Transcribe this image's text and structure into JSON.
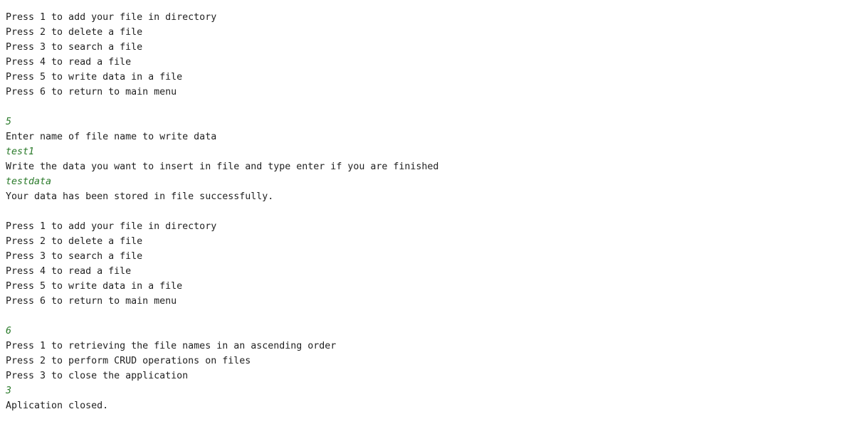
{
  "console": {
    "lines": [
      {
        "text": "Press 1 to add your file in directory",
        "kind": "output"
      },
      {
        "text": "Press 2 to delete a file",
        "kind": "output"
      },
      {
        "text": "Press 3 to search a file",
        "kind": "output"
      },
      {
        "text": "Press 4 to read a file",
        "kind": "output"
      },
      {
        "text": "Press 5 to write data in a file",
        "kind": "output"
      },
      {
        "text": "Press 6 to return to main menu",
        "kind": "output"
      },
      {
        "text": "",
        "kind": "output"
      },
      {
        "text": "5",
        "kind": "input"
      },
      {
        "text": "Enter name of file name to write data",
        "kind": "output"
      },
      {
        "text": "test1",
        "kind": "input"
      },
      {
        "text": "Write the data you want to insert in file and type enter if you are finished",
        "kind": "output"
      },
      {
        "text": "testdata",
        "kind": "input"
      },
      {
        "text": "Your data has been stored in file successfully.",
        "kind": "output"
      },
      {
        "text": "",
        "kind": "output"
      },
      {
        "text": "Press 1 to add your file in directory",
        "kind": "output"
      },
      {
        "text": "Press 2 to delete a file",
        "kind": "output"
      },
      {
        "text": "Press 3 to search a file",
        "kind": "output"
      },
      {
        "text": "Press 4 to read a file",
        "kind": "output"
      },
      {
        "text": "Press 5 to write data in a file",
        "kind": "output"
      },
      {
        "text": "Press 6 to return to main menu",
        "kind": "output"
      },
      {
        "text": "",
        "kind": "output"
      },
      {
        "text": "6",
        "kind": "input"
      },
      {
        "text": "Press 1 to retrieving the file names in an ascending order",
        "kind": "output"
      },
      {
        "text": "Press 2 to perform CRUD operations on files",
        "kind": "output"
      },
      {
        "text": "Press 3 to close the application",
        "kind": "output"
      },
      {
        "text": "3",
        "kind": "input"
      },
      {
        "text": "Aplication closed.",
        "kind": "output"
      }
    ]
  },
  "colors": {
    "output": "#1f1f1f",
    "input": "#2a7a2a",
    "background": "#ffffff"
  }
}
